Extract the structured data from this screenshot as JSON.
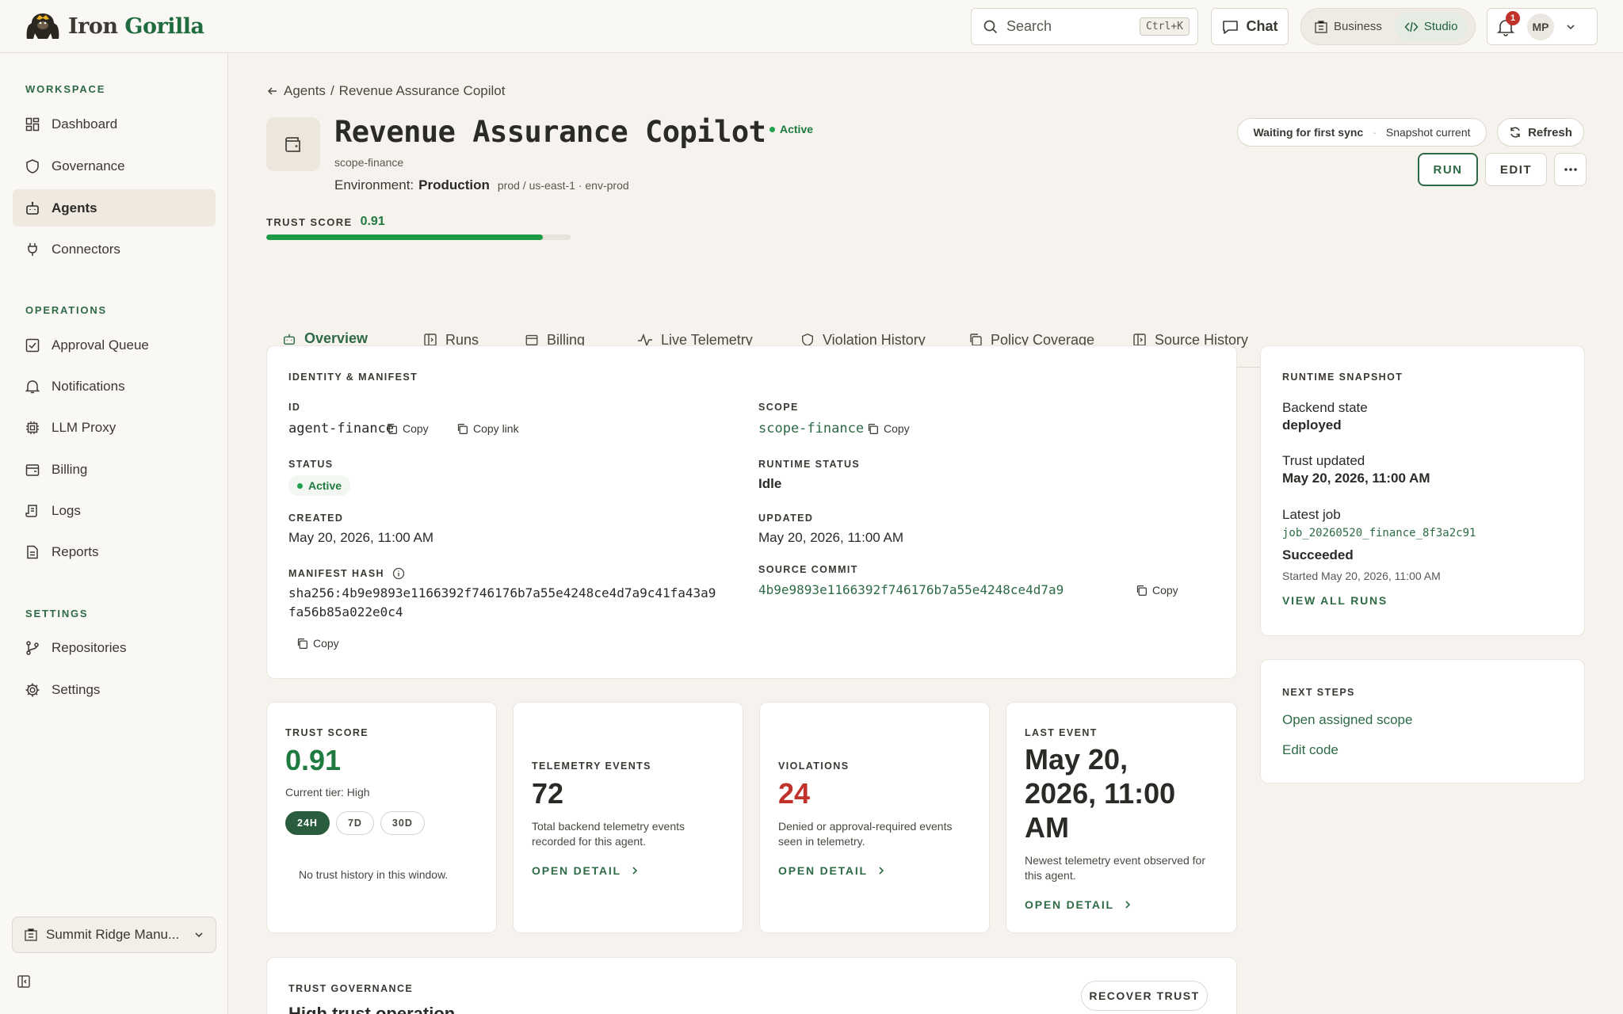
{
  "app": {
    "brand_part1": "Iron",
    "brand_part2": "Gorilla"
  },
  "topbar": {
    "search_placeholder": "Search",
    "search_shortcut": "Ctrl+K",
    "chat_label": "Chat",
    "modes": [
      "Business",
      "Studio"
    ],
    "active_mode": "Studio",
    "notification_count": "1",
    "user_initials": "MP"
  },
  "sidebar": {
    "sections": [
      {
        "title": "WORKSPACE",
        "items": [
          {
            "label": "Dashboard",
            "icon": "dashboard-icon"
          },
          {
            "label": "Governance",
            "icon": "shield-icon"
          },
          {
            "label": "Agents",
            "icon": "robot-icon",
            "active": true
          },
          {
            "label": "Connectors",
            "icon": "plug-icon"
          }
        ]
      },
      {
        "title": "OPERATIONS",
        "items": [
          {
            "label": "Approval Queue",
            "icon": "check-square-icon"
          },
          {
            "label": "Notifications",
            "icon": "bell-icon"
          },
          {
            "label": "LLM Proxy",
            "icon": "chip-icon"
          },
          {
            "label": "Billing",
            "icon": "wallet-icon"
          },
          {
            "label": "Logs",
            "icon": "scroll-icon"
          },
          {
            "label": "Reports",
            "icon": "document-icon"
          }
        ]
      },
      {
        "title": "SETTINGS",
        "items": [
          {
            "label": "Repositories",
            "icon": "git-branch-icon"
          },
          {
            "label": "Settings",
            "icon": "gear-icon"
          }
        ]
      }
    ],
    "org_name": "Summit Ridge Manu..."
  },
  "breadcrumb": {
    "parent": "Agents",
    "separator": "/",
    "current": "Revenue Assurance Copilot"
  },
  "agent": {
    "name": "Revenue Assurance Copilot",
    "status": "Active",
    "scope": "scope-finance",
    "environment_label": "Environment:",
    "environment": "Production",
    "environment_meta": "prod / us-east-1 · env-prod",
    "trust_score_label": "TRUST SCORE",
    "trust_score": "0.91",
    "trust_fraction": 0.91
  },
  "header_actions": {
    "sync_status": "Waiting for first sync",
    "snapshot_status": "Snapshot current",
    "refresh": "Refresh",
    "run": "RUN",
    "edit": "EDIT"
  },
  "tabs": [
    {
      "label": "Overview",
      "icon": "robot-icon",
      "active": true
    },
    {
      "label": "Runs",
      "icon": "play-panel-icon"
    },
    {
      "label": "Billing",
      "icon": "wallet-icon"
    },
    {
      "label": "Live Telemetry",
      "icon": "pulse-icon"
    },
    {
      "label": "Violation History",
      "icon": "shield-icon"
    },
    {
      "label": "Policy Coverage",
      "icon": "copy-icon"
    },
    {
      "label": "Source History",
      "icon": "play-panel-icon"
    }
  ],
  "identity": {
    "title": "IDENTITY & MANIFEST",
    "id_label": "ID",
    "id": "agent-finance",
    "copy": "Copy",
    "copy_link": "Copy link",
    "scope_label": "SCOPE",
    "scope": "scope-finance",
    "status_label": "STATUS",
    "status": "Active",
    "runtime_status_label": "RUNTIME STATUS",
    "runtime_status": "Idle",
    "created_label": "CREATED",
    "created": "May 20, 2026, 11:00 AM",
    "updated_label": "UPDATED",
    "updated": "May 20, 2026, 11:00 AM",
    "manifest_hash_label": "MANIFEST HASH",
    "manifest_hash_line1": "sha256:4b9e9893e1166392f746176b7a55e4248ce4d7a9c41fa43a9",
    "manifest_hash_line2": "fa56b85a022e0c4",
    "source_commit_label": "SOURCE COMMIT",
    "source_commit": "4b9e9893e1166392f746176b7a55e4248ce4d7a9"
  },
  "runtime": {
    "title": "RUNTIME SNAPSHOT",
    "backend_state_label": "Backend state",
    "backend_state": "deployed",
    "trust_updated_label": "Trust updated",
    "trust_updated": "May 20, 2026, 11:00 AM",
    "latest_job_label": "Latest job",
    "latest_job": "job_20260520_finance_8f3a2c91",
    "job_status": "Succeeded",
    "job_started": "Started May 20, 2026, 11:00 AM",
    "view_all": "VIEW ALL RUNS"
  },
  "next_steps": {
    "title": "NEXT STEPS",
    "links": [
      "Open assigned scope",
      "Edit code"
    ]
  },
  "metrics": {
    "trust": {
      "label": "TRUST SCORE",
      "value": "0.91",
      "tier": "Current tier: High",
      "ranges": [
        "24H",
        "7D",
        "30D"
      ],
      "active_range": "24H",
      "empty": "No trust history in this window."
    },
    "telemetry": {
      "label": "TELEMETRY EVENTS",
      "value": "72",
      "desc": "Total backend telemetry events recorded for this agent.",
      "link": "OPEN DETAIL"
    },
    "violations": {
      "label": "VIOLATIONS",
      "value": "24",
      "desc": "Denied or approval-required events seen in telemetry.",
      "link": "OPEN DETAIL"
    },
    "last_event": {
      "label": "LAST EVENT",
      "value_line1": "May 20,",
      "value_line2": "2026, 11:00",
      "value_line3": "AM",
      "desc": "Newest telemetry event observed for this agent.",
      "link": "OPEN DETAIL"
    }
  },
  "governance": {
    "title": "TRUST GOVERNANCE",
    "recover": "RECOVER TRUST",
    "partial_heading": "High trust operation"
  },
  "colors": {
    "accent": "#2d6a45",
    "success": "#1c9a44",
    "danger": "#c0322b",
    "background": "#f6f3ee"
  }
}
